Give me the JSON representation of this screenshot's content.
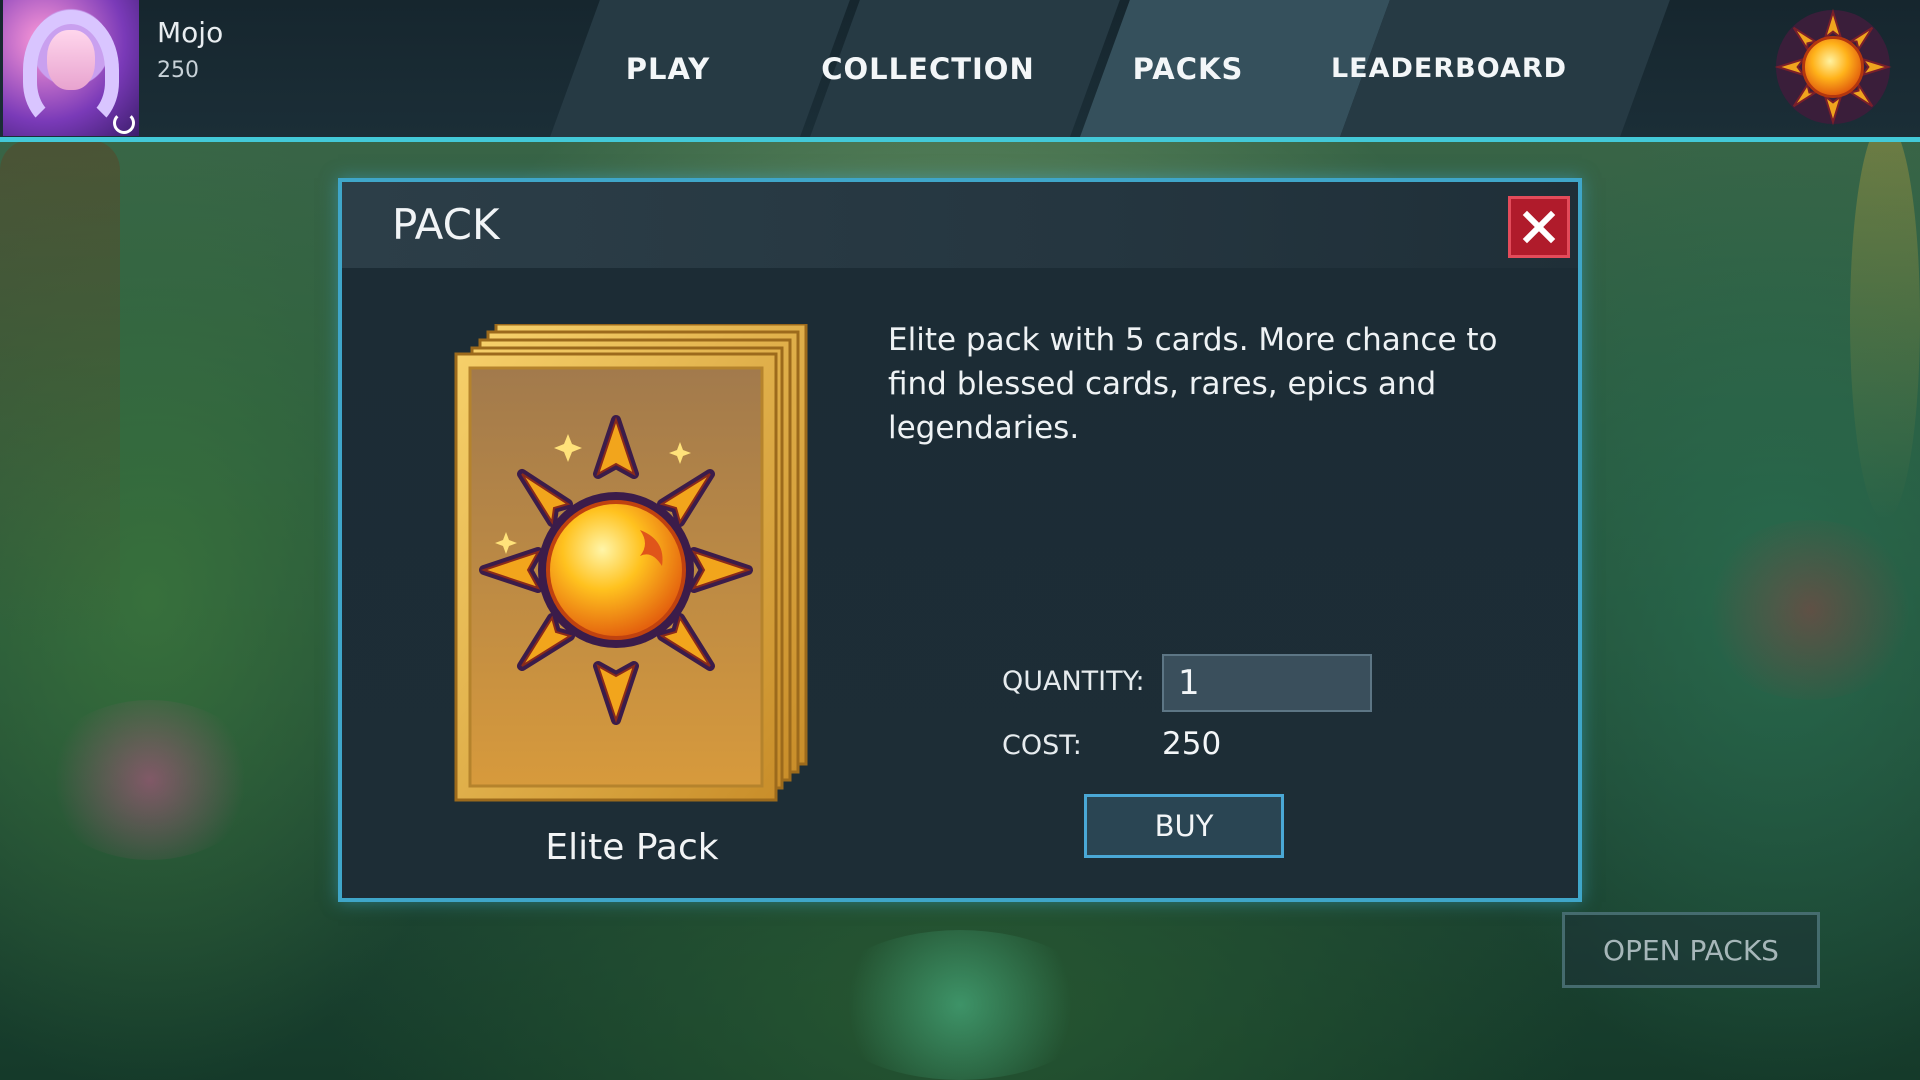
{
  "player": {
    "name": "Mojo",
    "coins": "250",
    "avatar_icon": "sorceress-portrait",
    "refresh_icon": "refresh-icon"
  },
  "nav": {
    "tabs": [
      {
        "label": "PLAY",
        "active": false
      },
      {
        "label": "COLLECTION",
        "active": false
      },
      {
        "label": "PACKS",
        "active": true
      },
      {
        "label": "LEADERBOARD",
        "active": false
      }
    ],
    "emblem_icon": "sun-emblem-icon"
  },
  "modal": {
    "title": "PACK",
    "close_icon": "close-icon",
    "pack": {
      "name": "Elite Pack",
      "art_icon": "sun-emblem-card-stack",
      "description": "Elite pack with 5 cards. More chance to find blessed cards, rares, epics and legendaries."
    },
    "quantity_label": "QUANTITY:",
    "quantity_value": "1",
    "cost_label": "COST:",
    "cost_value": "250",
    "buy_label": "BUY"
  },
  "open_packs_label": "OPEN PACKS",
  "colors": {
    "accent": "#43c9d8",
    "modal_border": "#3fa6c9",
    "close_red": "#b01b2b",
    "gold": "#e8b13a"
  }
}
